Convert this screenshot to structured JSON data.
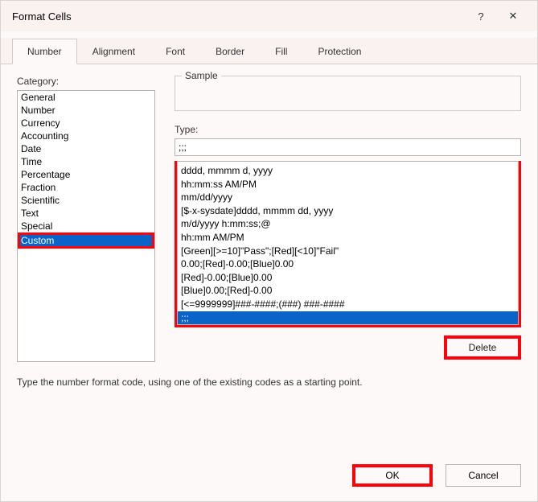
{
  "titlebar": {
    "title": "Format Cells",
    "help": "?",
    "close": "✕"
  },
  "tabs": {
    "items": [
      {
        "label": "Number"
      },
      {
        "label": "Alignment"
      },
      {
        "label": "Font"
      },
      {
        "label": "Border"
      },
      {
        "label": "Fill"
      },
      {
        "label": "Protection"
      }
    ]
  },
  "category": {
    "label": "Category:",
    "items": [
      "General",
      "Number",
      "Currency",
      "Accounting",
      "Date",
      "Time",
      "Percentage",
      "Fraction",
      "Scientific",
      "Text",
      "Special",
      "Custom"
    ],
    "selected_index": 11
  },
  "sample": {
    "label": "Sample"
  },
  "type": {
    "label": "Type:",
    "value": ";;;",
    "items": [
      "dddd, mmmm d, yyyy",
      "hh:mm:ss AM/PM",
      "mm/dd/yyyy",
      "[$-x-sysdate]dddd, mmmm dd, yyyy",
      "m/d/yyyy h:mm:ss;@",
      "hh:mm AM/PM",
      "[Green][>=10]\"Pass\";[Red][<10]\"Fail\"",
      "0.00;[Red]-0.00;[Blue]0.00",
      "[Red]-0.00;[Blue]0.00",
      "[Blue]0.00;[Red]-0.00",
      "[<=9999999]###-####;(###) ###-####",
      ";;;"
    ],
    "selected_index": 11
  },
  "buttons": {
    "delete": "Delete",
    "ok": "OK",
    "cancel": "Cancel"
  },
  "hint": "Type the number format code, using one of the existing codes as a starting point."
}
